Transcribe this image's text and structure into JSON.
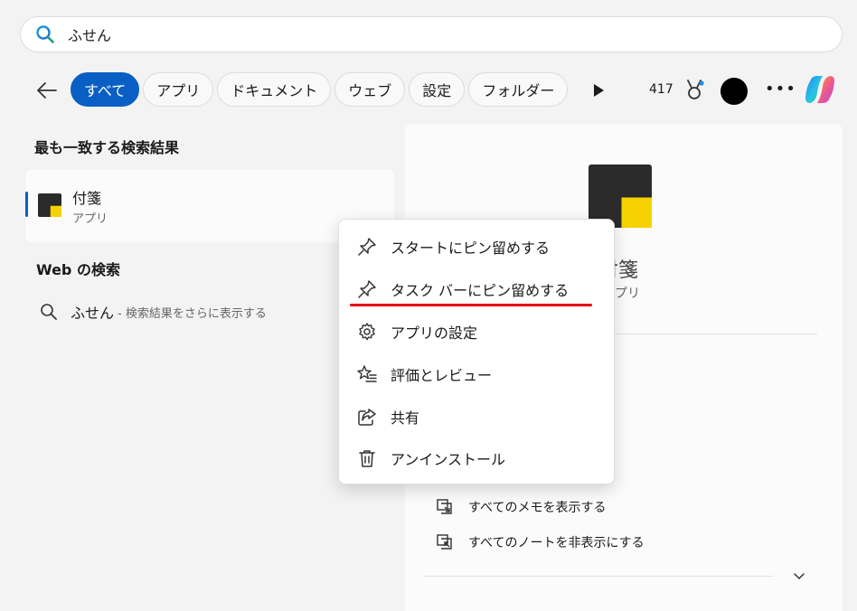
{
  "search": {
    "query": "ふせん"
  },
  "filters": {
    "chips": [
      "すべて",
      "アプリ",
      "ドキュメント",
      "ウェブ",
      "設定",
      "フォルダー"
    ],
    "active_index": 0
  },
  "header": {
    "points": "417"
  },
  "best_match": {
    "section_title": "最も一致する検索結果",
    "name": "付箋",
    "type": "アプリ"
  },
  "web": {
    "section_title": "Web の検索",
    "query": "ふせん",
    "hint": "- 検索結果をさらに表示する"
  },
  "preview": {
    "name": "付箋",
    "type": "アプリ",
    "actions": [
      "すべてのメモを表示する",
      "すべてのノートを非表示にする"
    ]
  },
  "context_menu": {
    "items": [
      {
        "label": "スタートにピン留めする",
        "icon": "pin-icon"
      },
      {
        "label": "タスク バーにピン留めする",
        "icon": "pin-icon"
      },
      {
        "label": "アプリの設定",
        "icon": "gear-icon"
      },
      {
        "label": "評価とレビュー",
        "icon": "star-list-icon"
      },
      {
        "label": "共有",
        "icon": "share-icon"
      },
      {
        "label": "アンインストール",
        "icon": "trash-icon"
      }
    ]
  },
  "colors": {
    "accent": "#0a5fc4",
    "highlight": "#e60012",
    "app_yellow": "#f5d200"
  }
}
